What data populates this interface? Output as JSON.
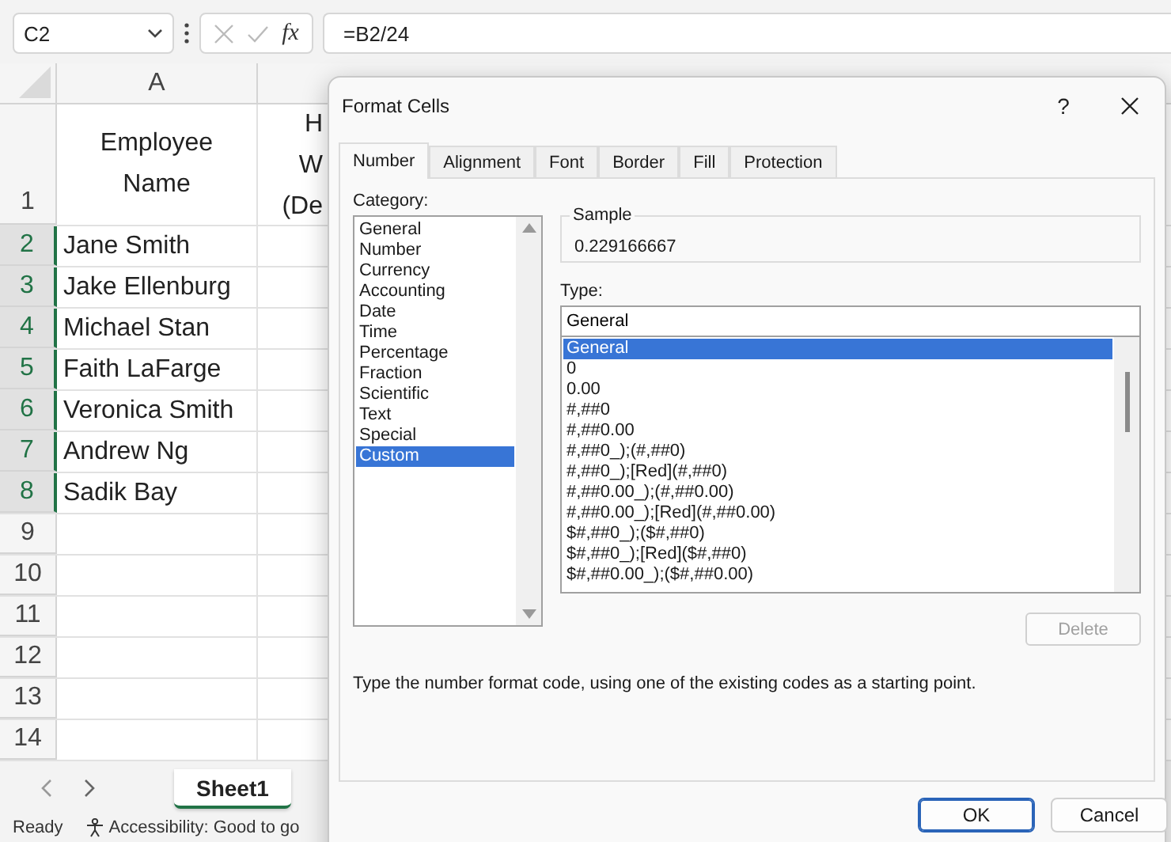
{
  "formula_bar": {
    "name_box": "C2",
    "function_label": "fx",
    "formula": "=B2/24"
  },
  "columns": [
    {
      "label": "A"
    }
  ],
  "header_row": {
    "number": "1",
    "name_header": "Employee Name",
    "partial_header_lines": [
      "H",
      "W",
      "(De"
    ]
  },
  "rows": [
    {
      "number": "2",
      "name": "Jane Smith",
      "selected": true
    },
    {
      "number": "3",
      "name": "Jake Ellenburg",
      "selected": true
    },
    {
      "number": "4",
      "name": "Michael Stan",
      "selected": true
    },
    {
      "number": "5",
      "name": "Faith LaFarge",
      "selected": true
    },
    {
      "number": "6",
      "name": "Veronica Smith",
      "selected": true
    },
    {
      "number": "7",
      "name": "Andrew Ng",
      "selected": true
    },
    {
      "number": "8",
      "name": "Sadik Bay",
      "selected": true
    },
    {
      "number": "9",
      "selected": false
    },
    {
      "number": "10",
      "selected": false
    },
    {
      "number": "11",
      "selected": false
    },
    {
      "number": "12",
      "selected": false
    },
    {
      "number": "13",
      "selected": false
    },
    {
      "number": "14",
      "selected": false
    }
  ],
  "sheet_tabs": [
    {
      "label": "Sheet1",
      "selected": true
    }
  ],
  "status_bar": {
    "mode": "Ready",
    "accessibility": "Accessibility: Good to go"
  },
  "dialog": {
    "title": "Format Cells",
    "help": "?",
    "tabs": [
      {
        "label": "Number",
        "selected": true
      },
      {
        "label": "Alignment",
        "selected": false
      },
      {
        "label": "Font",
        "selected": false
      },
      {
        "label": "Border",
        "selected": false
      },
      {
        "label": "Fill",
        "selected": false
      },
      {
        "label": "Protection",
        "selected": false
      }
    ],
    "category_label": "Category:",
    "categories": [
      {
        "label": "General",
        "selected": false
      },
      {
        "label": "Number",
        "selected": false
      },
      {
        "label": "Currency",
        "selected": false
      },
      {
        "label": "Accounting",
        "selected": false
      },
      {
        "label": "Date",
        "selected": false
      },
      {
        "label": "Time",
        "selected": false
      },
      {
        "label": "Percentage",
        "selected": false
      },
      {
        "label": "Fraction",
        "selected": false
      },
      {
        "label": "Scientific",
        "selected": false
      },
      {
        "label": "Text",
        "selected": false
      },
      {
        "label": "Special",
        "selected": false
      },
      {
        "label": "Custom",
        "selected": true
      }
    ],
    "sample_label": "Sample",
    "sample_value": "0.229166667",
    "type_label": "Type:",
    "type_value": "General",
    "type_codes": [
      {
        "label": "General",
        "selected": true
      },
      {
        "label": "0",
        "selected": false
      },
      {
        "label": "0.00",
        "selected": false
      },
      {
        "label": "#,##0",
        "selected": false
      },
      {
        "label": "#,##0.00",
        "selected": false
      },
      {
        "label": "#,##0_);(#,##0)",
        "selected": false
      },
      {
        "label": "#,##0_);[Red](#,##0)",
        "selected": false
      },
      {
        "label": "#,##0.00_);(#,##0.00)",
        "selected": false
      },
      {
        "label": "#,##0.00_);[Red](#,##0.00)",
        "selected": false
      },
      {
        "label": "$#,##0_);($#,##0)",
        "selected": false
      },
      {
        "label": "$#,##0_);[Red]($#,##0)",
        "selected": false
      },
      {
        "label": "$#,##0.00_);($#,##0.00)",
        "selected": false
      }
    ],
    "delete_button": {
      "label": "Delete",
      "disabled": true
    },
    "description": "Type the number format code, using one of the existing codes as a starting point.",
    "buttons": [
      {
        "label": "OK",
        "default": true
      },
      {
        "label": "Cancel",
        "default": false
      }
    ]
  }
}
